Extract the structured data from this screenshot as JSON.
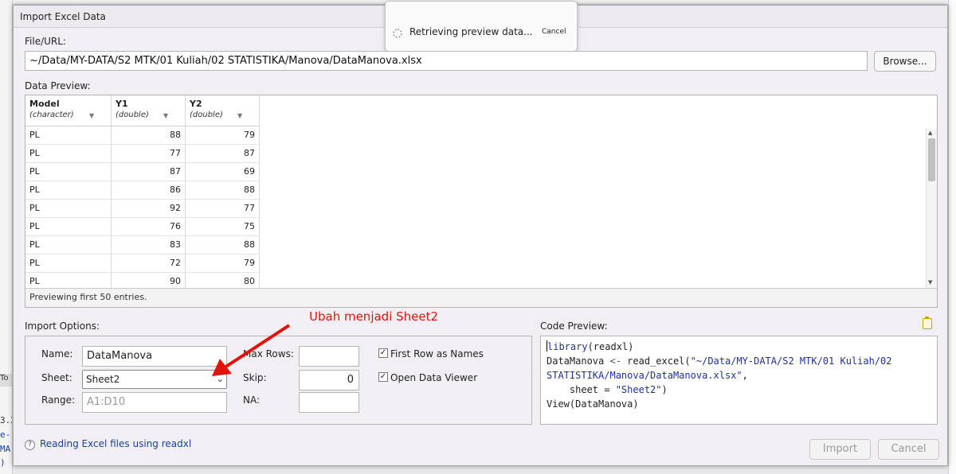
{
  "dialog": {
    "title": "Import Excel Data"
  },
  "toast": {
    "message": "Retrieving preview data...",
    "cancel_label": "Cancel"
  },
  "file": {
    "label": "File/URL:",
    "value": "~/Data/MY-DATA/S2 MTK/01 Kuliah/02 STATISTIKA/Manova/DataManova.xlsx",
    "browse_label": "Browse..."
  },
  "preview": {
    "label": "Data Preview:",
    "columns": [
      {
        "name": "Model",
        "type": "(character)"
      },
      {
        "name": "Y1",
        "type": "(double)"
      },
      {
        "name": "Y2",
        "type": "(double)"
      }
    ],
    "rows": [
      [
        "PL",
        "88",
        "79"
      ],
      [
        "PL",
        "77",
        "87"
      ],
      [
        "PL",
        "87",
        "69"
      ],
      [
        "PL",
        "86",
        "88"
      ],
      [
        "PL",
        "92",
        "77"
      ],
      [
        "PL",
        "76",
        "75"
      ],
      [
        "PL",
        "83",
        "88"
      ],
      [
        "PL",
        "72",
        "79"
      ],
      [
        "PL",
        "90",
        "80"
      ]
    ],
    "footer": "Previewing first 50 entries."
  },
  "options": {
    "label": "Import Options:",
    "name_label": "Name:",
    "name_value": "DataManova",
    "sheet_label": "Sheet:",
    "sheet_value": "Sheet2",
    "range_label": "Range:",
    "range_placeholder": "A1:D10",
    "maxrows_label": "Max Rows:",
    "maxrows_value": "",
    "skip_label": "Skip:",
    "skip_value": "0",
    "na_label": "NA:",
    "na_value": "",
    "first_row_label": "First Row as Names",
    "first_row_checked": true,
    "open_viewer_label": "Open Data Viewer",
    "open_viewer_checked": true
  },
  "code": {
    "label": "Code Preview:",
    "kw_library": "library",
    "lib_arg": "(readxl)",
    "assign_lhs": "DataManova",
    "assign_op": " <- ",
    "fn": "read_excel(",
    "path_1": "\"~/Data/MY-DATA/S2 MTK/01 Kuliah/02",
    "path_2": "STATISTIKA/Manova/DataManova.xlsx\"",
    "comma": ",",
    "sheet_arg": "    sheet = ",
    "sheet_str": "\"Sheet2\"",
    "close": ")",
    "view": "View(DataManova)"
  },
  "annotation": {
    "text": "Ubah menjadi Sheet2",
    "color": "#e0140a"
  },
  "help": {
    "link": "Reading Excel files using readxl"
  },
  "buttons": {
    "import": "Import",
    "cancel": "Cancel"
  },
  "background": {
    "tab_label": "To",
    "code_1": "3.2",
    "code_2": "e-",
    "code_3": "MA",
    "code_4": ")"
  }
}
